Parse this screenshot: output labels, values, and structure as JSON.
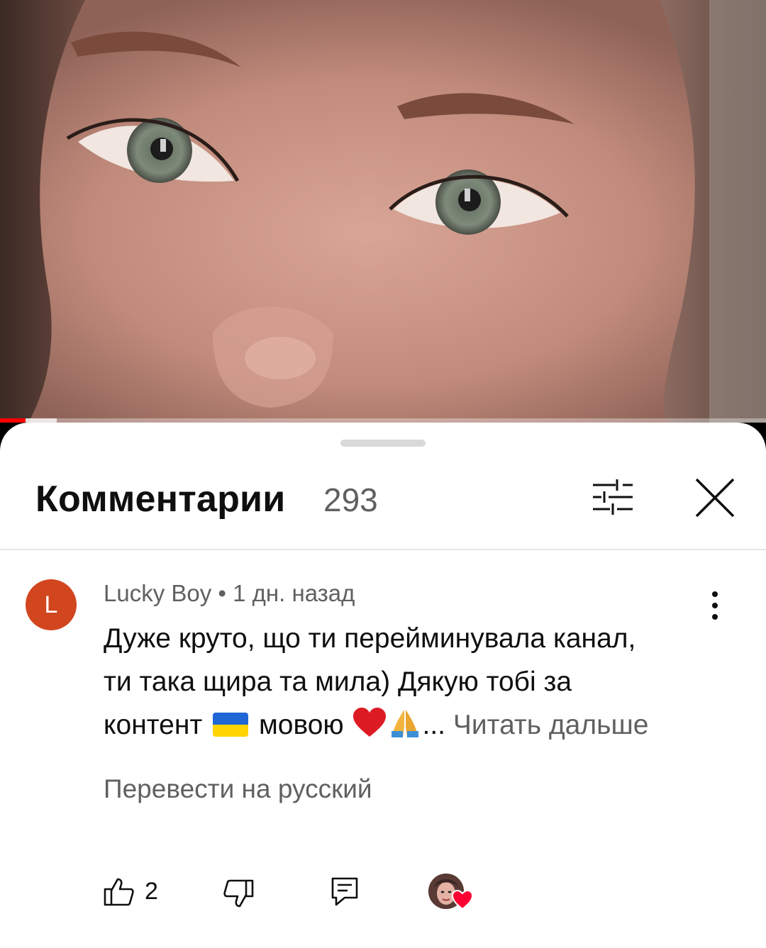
{
  "video": {
    "progress_fraction": 0.033,
    "buffered_fraction": 0.074
  },
  "comments_sheet": {
    "title": "Комментарии",
    "count": "293",
    "icons": {
      "filter": "sort-filter-icon",
      "close": "close-icon"
    }
  },
  "comment": {
    "avatar_letter": "L",
    "avatar_color": "#d2461f",
    "meta": "Lucky Boy • 1 дн. назад",
    "text_line1": "Дуже круто, що ти перейминувала канал,",
    "text_line2": "ти така щира та мила) Дякую тобі за",
    "text_line3_a": "контент",
    "text_line3_b": "мовою",
    "text_line3_c": "...",
    "read_more": "Читать дальше",
    "translate": "Перевести на русский",
    "like_count": "2",
    "icons": {
      "like": "thumbs-up-icon",
      "dislike": "thumbs-down-icon",
      "reply": "reply-icon",
      "more": "more-vert-icon",
      "creator_heart": "creator-heart-icon"
    }
  },
  "colors": {
    "accent_red": "#ff0000",
    "secondary_text": "#606060",
    "primary_text": "#0f0f0f"
  }
}
